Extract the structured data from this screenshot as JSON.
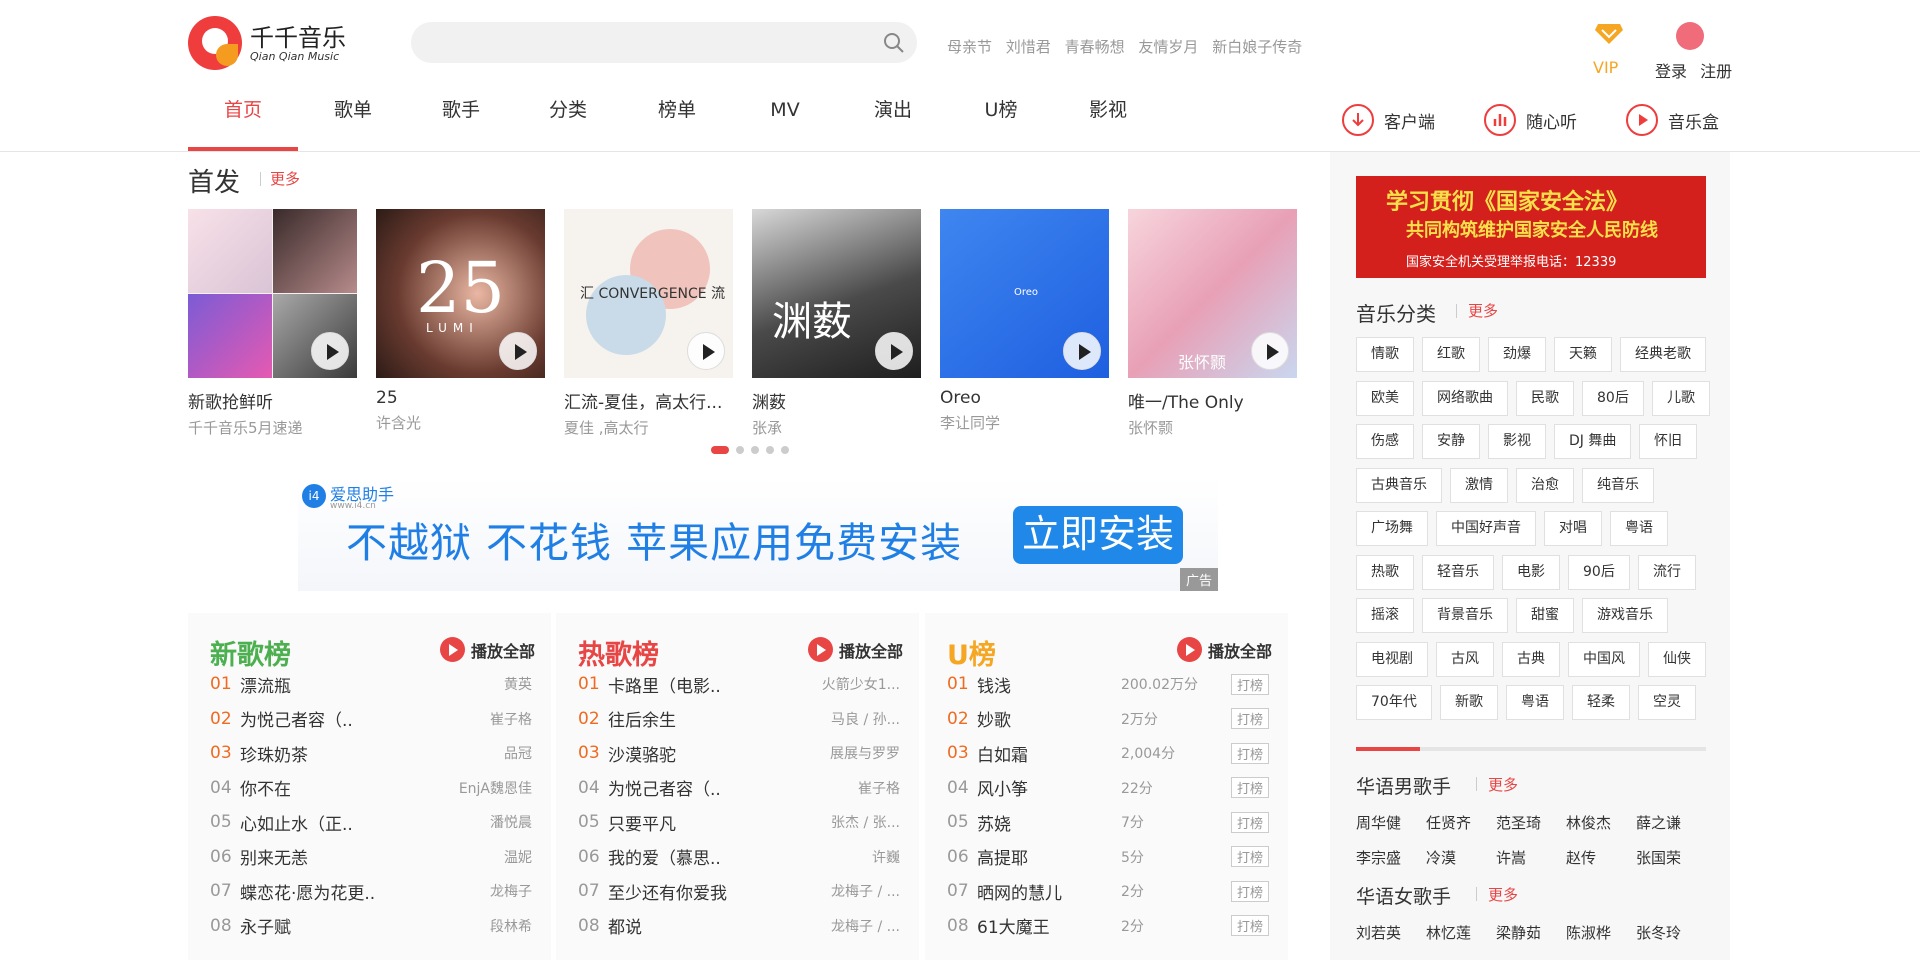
{
  "header": {
    "logo_cn": "千千音乐",
    "logo_en": "Qian Qian Music",
    "search_placeholder": "",
    "hot_searches": [
      "母亲节",
      "刘惜君",
      "青春畅想",
      "友情岁月",
      "新白娘子传奇"
    ],
    "vip_label": "VIP",
    "login_label": "登录",
    "register_label": "注册"
  },
  "nav": {
    "items": [
      "首页",
      "歌单",
      "歌手",
      "分类",
      "榜单",
      "MV",
      "演出",
      "U榜",
      "影视"
    ],
    "active": "首页"
  },
  "tools": [
    {
      "label": "客户端",
      "icon": "download-icon"
    },
    {
      "label": "随心听",
      "icon": "equalizer-icon"
    },
    {
      "label": "音乐盒",
      "icon": "play-icon"
    }
  ],
  "premiere": {
    "title": "首发",
    "more": "更多",
    "albums": [
      {
        "title": "新歌抢鲜听",
        "artist": "千千音乐5月速递"
      },
      {
        "title": "25",
        "artist": "许含光"
      },
      {
        "title": "汇流-夏佳，高太行...",
        "artist": "夏佳 ,高太行"
      },
      {
        "title": "渊薮",
        "artist": "张承"
      },
      {
        "title": "Oreo",
        "artist": "李让同学"
      },
      {
        "title": "唯一/The Only",
        "artist": "张怀颢"
      }
    ],
    "cover_texts": {
      "c2": "25",
      "c2b": "LUMI",
      "c3": "汇 CONVERGENCE 流",
      "c4": "渊薮",
      "c5": "Oreo",
      "c6": "张怀颢"
    }
  },
  "ad": {
    "logo": "爱思助手",
    "logo_url_text": "www.i4.cn",
    "text": "不越狱 不花钱 苹果应用免费安装",
    "button": "立即安装",
    "tag": "广告"
  },
  "charts": [
    {
      "title": "新歌榜",
      "color": "#4caf50",
      "play_all": "播放全部",
      "rows": [
        {
          "rank": "01",
          "song": "漂流瓶",
          "singer": "黄英"
        },
        {
          "rank": "02",
          "song": "为悦己者容（..",
          "singer": "崔子格"
        },
        {
          "rank": "03",
          "song": "珍珠奶茶",
          "singer": "品冠"
        },
        {
          "rank": "04",
          "song": "你不在",
          "singer": "EnjA魏恩佳"
        },
        {
          "rank": "05",
          "song": "心如止水（正..",
          "singer": "潘悦晨"
        },
        {
          "rank": "06",
          "song": "别来无恙",
          "singer": "温妮"
        },
        {
          "rank": "07",
          "song": "蝶恋花·愿为花更..",
          "singer": "龙梅子"
        },
        {
          "rank": "08",
          "song": "永子赋",
          "singer": "段林希"
        }
      ]
    },
    {
      "title": "热歌榜",
      "color": "#e84545",
      "play_all": "播放全部",
      "rows": [
        {
          "rank": "01",
          "song": "卡路里（电影..",
          "singer": "火箭少女1..."
        },
        {
          "rank": "02",
          "song": "往后余生",
          "singer": "马良 / 孙..."
        },
        {
          "rank": "03",
          "song": "沙漠骆驼",
          "singer": "展展与罗罗"
        },
        {
          "rank": "04",
          "song": "为悦己者容（..",
          "singer": "崔子格"
        },
        {
          "rank": "05",
          "song": "只要平凡",
          "singer": "张杰 / 张..."
        },
        {
          "rank": "06",
          "song": "我的爱（慕思..",
          "singer": "许巍"
        },
        {
          "rank": "07",
          "song": "至少还有你爱我",
          "singer": "龙梅子 / ..."
        },
        {
          "rank": "08",
          "song": "都说",
          "singer": "龙梅子 / ..."
        }
      ]
    },
    {
      "title": "U榜",
      "color": "#f5a623",
      "play_all": "播放全部",
      "button_label": "打榜",
      "rows": [
        {
          "rank": "01",
          "song": "钱浅",
          "hits": "200.02万分"
        },
        {
          "rank": "02",
          "song": "妙歌",
          "hits": "2万分"
        },
        {
          "rank": "03",
          "song": "白如霜",
          "hits": "2,004分"
        },
        {
          "rank": "04",
          "song": "风小筝",
          "hits": "22分"
        },
        {
          "rank": "05",
          "song": "苏娆",
          "hits": "7分"
        },
        {
          "rank": "06",
          "song": "高提耶",
          "hits": "5分"
        },
        {
          "rank": "07",
          "song": "晒网的慧儿",
          "hits": "2分"
        },
        {
          "rank": "08",
          "song": "61大魔王",
          "hits": "2分"
        }
      ]
    }
  ],
  "sidebar": {
    "ad_line1": "学习贯彻《国家安全法》",
    "ad_line2": "共同构筑维护国家安全人民防线",
    "ad_line3": "国家安全机关受理举报电话：12339",
    "category_title": "音乐分类",
    "more": "更多",
    "tags": [
      [
        "情歌",
        "红歌",
        "劲爆",
        "天籁",
        "经典老歌"
      ],
      [
        "欧美",
        "网络歌曲",
        "民歌",
        "80后",
        "儿歌"
      ],
      [
        "伤感",
        "安静",
        "影视",
        "DJ 舞曲",
        "怀旧"
      ],
      [
        "古典音乐",
        "激情",
        "治愈",
        "纯音乐"
      ],
      [
        "广场舞",
        "中国好声音",
        "对唱",
        "粤语"
      ],
      [
        "热歌",
        "轻音乐",
        "电影",
        "90后",
        "流行"
      ],
      [
        "摇滚",
        "背景音乐",
        "甜蜜",
        "游戏音乐"
      ],
      [
        "电视剧",
        "古风",
        "古典",
        "中国风",
        "仙侠"
      ],
      [
        "70年代",
        "新歌",
        "粤语",
        "轻柔",
        "空灵"
      ]
    ],
    "male_title": "华语男歌手",
    "male": [
      [
        "周华健",
        "任贤齐",
        "范圣琦",
        "林俊杰",
        "薛之谦"
      ],
      [
        "李宗盛",
        "冷漠",
        "许嵩",
        "赵传",
        "张国荣"
      ]
    ],
    "female_title": "华语女歌手",
    "female": [
      [
        "刘若英",
        "林忆莲",
        "梁静茹",
        "陈淑桦",
        "张冬玲"
      ]
    ]
  }
}
